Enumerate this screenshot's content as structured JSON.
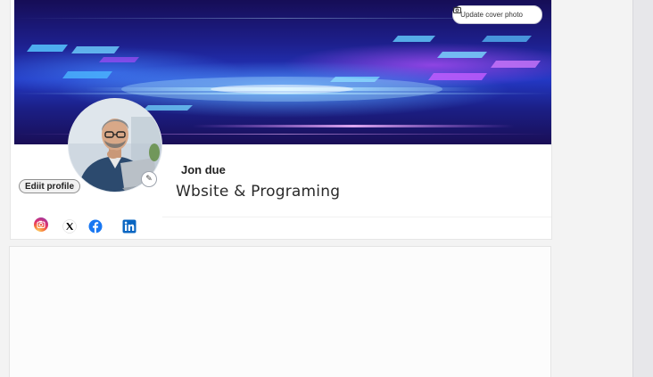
{
  "cover": {
    "update_button_label": "Update cover photo",
    "update_button_icon": "camera-icon"
  },
  "profile": {
    "name": "Jon due",
    "headline": "Wbsite & Programing",
    "edit_button_label": "Ediit profile",
    "edit_avatar_icon": "pencil-icon"
  },
  "social": [
    {
      "name": "instagram",
      "icon": "instagram-icon",
      "color": "#e1306c"
    },
    {
      "name": "x",
      "icon": "x-icon",
      "color": "#000000"
    },
    {
      "name": "facebook",
      "icon": "facebook-icon",
      "color": "#1877f2"
    },
    {
      "name": "linkedin",
      "icon": "linkedin-icon",
      "color": "#0a66c2"
    }
  ]
}
